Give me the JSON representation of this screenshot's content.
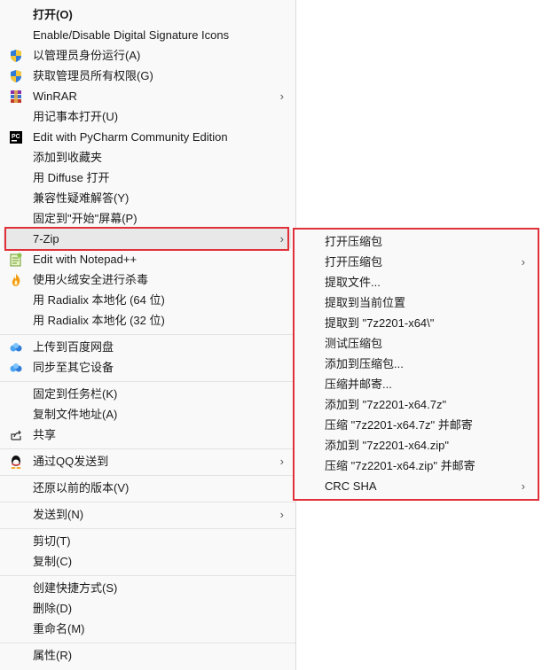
{
  "menu": {
    "items": [
      {
        "label": "打开(O)",
        "bold": true
      },
      {
        "label": "Enable/Disable Digital Signature Icons"
      },
      {
        "label": "以管理员身份运行(A)",
        "icon": "shield-icon"
      },
      {
        "label": "获取管理员所有权限(G)",
        "icon": "shield-icon"
      },
      {
        "label": "WinRAR",
        "icon": "winrar-icon",
        "submenu": true
      },
      {
        "label": "用记事本打开(U)"
      },
      {
        "label": "Edit with PyCharm Community Edition",
        "icon": "pycharm-icon"
      },
      {
        "label": "添加到收藏夹"
      },
      {
        "label": "用 Diffuse 打开"
      },
      {
        "label": "兼容性疑难解答(Y)"
      },
      {
        "label": "固定到\"开始\"屏幕(P)"
      },
      {
        "label": "7-Zip",
        "submenu": true,
        "highlighted": true
      },
      {
        "label": "Edit with Notepad++",
        "icon": "notepad-plus-plus-icon"
      },
      {
        "label": "使用火绒安全进行杀毒",
        "icon": "huorong-icon"
      },
      {
        "label": "用 Radialix 本地化 (64 位)"
      },
      {
        "label": "用 Radialix 本地化 (32 位)"
      },
      {
        "label": "上传到百度网盘",
        "icon": "baidu-netdisk-icon"
      },
      {
        "label": "同步至其它设备",
        "icon": "baidu-netdisk-icon"
      },
      {
        "label": "固定到任务栏(K)"
      },
      {
        "label": "复制文件地址(A)"
      },
      {
        "label": "共享",
        "icon": "share-icon"
      },
      {
        "label": "通过QQ发送到",
        "icon": "qq-icon",
        "submenu": true
      },
      {
        "label": "还原以前的版本(V)"
      },
      {
        "label": "发送到(N)",
        "submenu": true
      },
      {
        "label": "剪切(T)"
      },
      {
        "label": "复制(C)"
      },
      {
        "label": "创建快捷方式(S)"
      },
      {
        "label": "删除(D)"
      },
      {
        "label": "重命名(M)"
      },
      {
        "label": "属性(R)"
      }
    ]
  },
  "submenu_7zip": {
    "items": [
      {
        "label": "打开压缩包"
      },
      {
        "label": "打开压缩包",
        "submenu": true
      },
      {
        "label": "提取文件..."
      },
      {
        "label": "提取到当前位置"
      },
      {
        "label": "提取到 \"7z2201-x64\\\""
      },
      {
        "label": "测试压缩包"
      },
      {
        "label": "添加到压缩包..."
      },
      {
        "label": "压缩并邮寄..."
      },
      {
        "label": "添加到 \"7z2201-x64.7z\""
      },
      {
        "label": "压缩 \"7z2201-x64.7z\" 并邮寄"
      },
      {
        "label": "添加到 \"7z2201-x64.zip\""
      },
      {
        "label": "压缩 \"7z2201-x64.zip\" 并邮寄"
      },
      {
        "label": "CRC SHA",
        "submenu": true
      }
    ]
  },
  "colors": {
    "highlight_box": "#e0303a",
    "menu_bg": "#f9f9f9"
  }
}
